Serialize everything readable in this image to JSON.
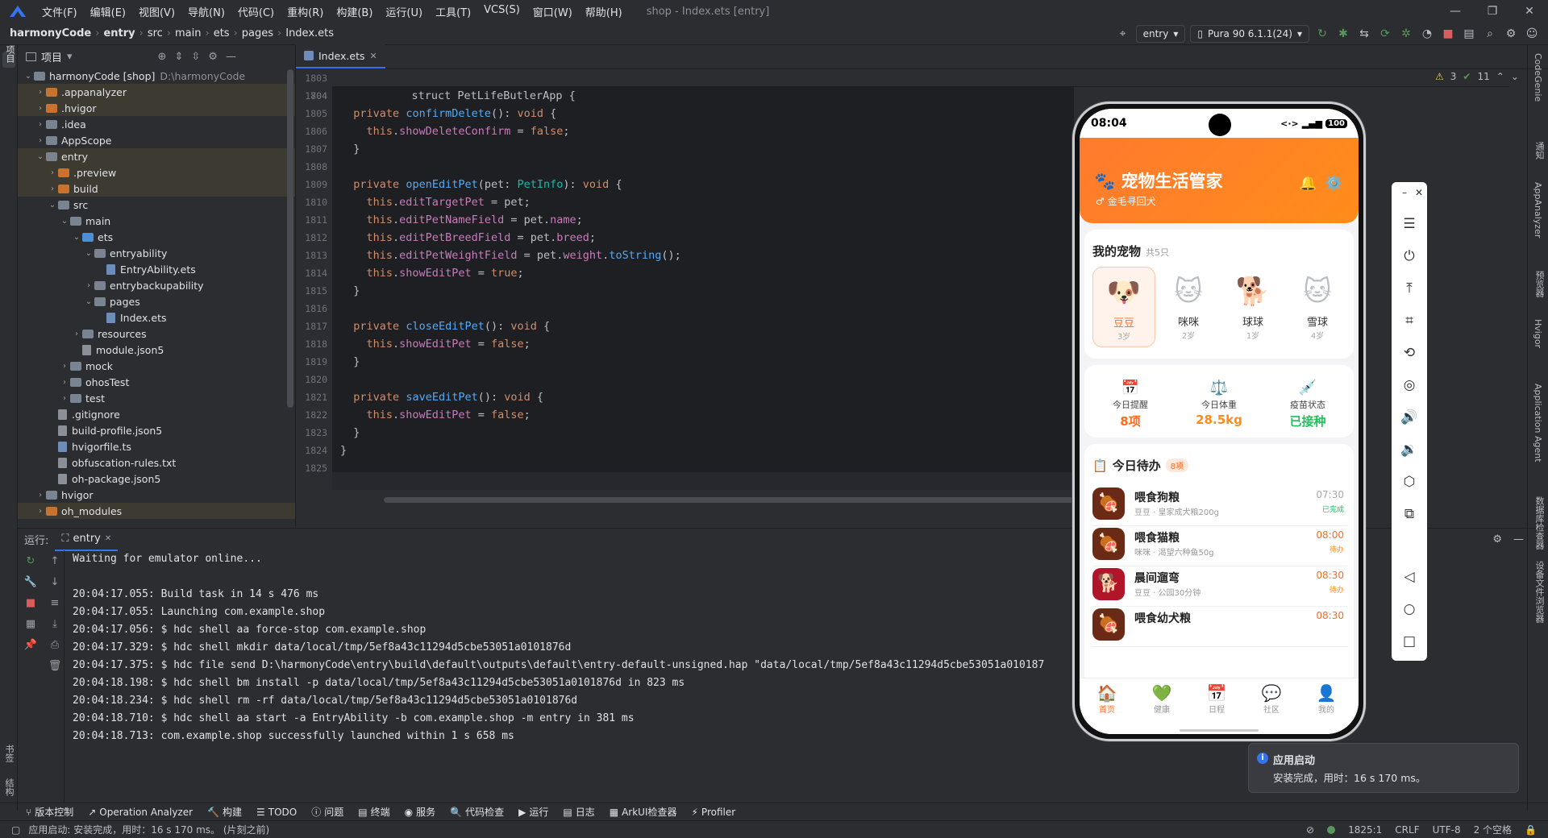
{
  "menu": [
    "文件(F)",
    "编辑(E)",
    "视图(V)",
    "导航(N)",
    "代码(C)",
    "重构(R)",
    "构建(B)",
    "运行(U)",
    "工具(T)",
    "VCS(S)",
    "窗口(W)",
    "帮助(H)"
  ],
  "window_title": "shop - Index.ets [entry]",
  "breadcrumb": [
    "harmonyCode",
    "entry",
    "src",
    "main",
    "ets",
    "pages",
    "Index.ets"
  ],
  "run_config": "entry",
  "device": "Pura 90 6.1.1(24)",
  "project_panel": {
    "title": "项目",
    "tree": [
      {
        "label": "harmonyCode [shop]",
        "extra": "D:\\harmonyCode",
        "indent": 0,
        "type": "g",
        "open": true,
        "hl": false
      },
      {
        "label": ".appanalyzer",
        "indent": 1,
        "type": "o",
        "open": false,
        "hl": true
      },
      {
        "label": ".hvigor",
        "indent": 1,
        "type": "o",
        "open": false,
        "hl": true
      },
      {
        "label": ".idea",
        "indent": 1,
        "type": "g",
        "open": false,
        "hl": false
      },
      {
        "label": "AppScope",
        "indent": 1,
        "type": "g",
        "open": false,
        "hl": false
      },
      {
        "label": "entry",
        "indent": 1,
        "type": "g",
        "open": true,
        "hl": true
      },
      {
        "label": ".preview",
        "indent": 2,
        "type": "o",
        "open": false,
        "hl": true
      },
      {
        "label": "build",
        "indent": 2,
        "type": "o",
        "open": false,
        "hl": true
      },
      {
        "label": "src",
        "indent": 2,
        "type": "g",
        "open": true,
        "hl": false
      },
      {
        "label": "main",
        "indent": 3,
        "type": "g",
        "open": true,
        "hl": false
      },
      {
        "label": "ets",
        "indent": 4,
        "type": "b",
        "open": true,
        "hl": false
      },
      {
        "label": "entryability",
        "indent": 5,
        "type": "g",
        "open": true,
        "hl": false
      },
      {
        "label": "EntryAbility.ets",
        "indent": 6,
        "type": "file",
        "hl": false
      },
      {
        "label": "entrybackupability",
        "indent": 5,
        "type": "g",
        "open": false,
        "hl": false
      },
      {
        "label": "pages",
        "indent": 5,
        "type": "g",
        "open": true,
        "hl": false
      },
      {
        "label": "Index.ets",
        "indent": 6,
        "type": "file",
        "hl": false
      },
      {
        "label": "resources",
        "indent": 4,
        "type": "g",
        "open": false,
        "hl": false
      },
      {
        "label": "module.json5",
        "indent": 4,
        "type": "json",
        "hl": false
      },
      {
        "label": "mock",
        "indent": 3,
        "type": "g",
        "open": false,
        "hl": false
      },
      {
        "label": "ohosTest",
        "indent": 3,
        "type": "g",
        "open": false,
        "hl": false
      },
      {
        "label": "test",
        "indent": 3,
        "type": "g",
        "open": false,
        "hl": false
      },
      {
        "label": ".gitignore",
        "indent": 2,
        "type": "json",
        "hl": false
      },
      {
        "label": "build-profile.json5",
        "indent": 2,
        "type": "json",
        "hl": false
      },
      {
        "label": "hvigorfile.ts",
        "indent": 2,
        "type": "file",
        "hl": false
      },
      {
        "label": "obfuscation-rules.txt",
        "indent": 2,
        "type": "json",
        "hl": false
      },
      {
        "label": "oh-package.json5",
        "indent": 2,
        "type": "json",
        "hl": false
      },
      {
        "label": "hvigor",
        "indent": 1,
        "type": "g",
        "open": false,
        "hl": false
      },
      {
        "label": "oh_modules",
        "indent": 1,
        "type": "o",
        "open": false,
        "hl": true
      }
    ]
  },
  "editor": {
    "tab": "Index.ets",
    "sticky_line": "704",
    "sticky": "struct PetLifeButlerApp {",
    "first_line": "1803",
    "inspections": {
      "warnings": "3",
      "ok": "11"
    },
    "lines": [
      {
        "n": "1804",
        "html": ""
      },
      {
        "n": "1805",
        "html": "  <span class='kw'>private</span> <span class='fn'>confirmDelete</span>(): <span class='kw'>void</span> {"
      },
      {
        "n": "1806",
        "html": "    <span class='kw'>this</span>.<span class='pr'>showDeleteConfirm</span> = <span class='kw'>false</span>;"
      },
      {
        "n": "1807",
        "html": "  }"
      },
      {
        "n": "1808",
        "html": ""
      },
      {
        "n": "1809",
        "html": "  <span class='kw'>private</span> <span class='fn'>openEditPet</span>(pet: <span class='ty'>PetInfo</span>): <span class='kw'>void</span> {"
      },
      {
        "n": "1810",
        "html": "    <span class='kw'>this</span>.<span class='pr'>editTargetPet</span> = pet;"
      },
      {
        "n": "1811",
        "html": "    <span class='kw'>this</span>.<span class='pr'>editPetNameField</span> = pet.<span class='pr'>name</span>;"
      },
      {
        "n": "1812",
        "html": "    <span class='kw'>this</span>.<span class='pr'>editPetBreedField</span> = pet.<span class='pr'>breed</span>;"
      },
      {
        "n": "1813",
        "html": "    <span class='kw'>this</span>.<span class='pr'>editPetWeightField</span> = pet.<span class='pr'>weight</span>.<span class='fn'>toString</span>();"
      },
      {
        "n": "1814",
        "html": "    <span class='kw'>this</span>.<span class='pr'>showEditPet</span> = <span class='kw'>true</span>;"
      },
      {
        "n": "1815",
        "html": "  }"
      },
      {
        "n": "1816",
        "html": ""
      },
      {
        "n": "1817",
        "html": "  <span class='kw'>private</span> <span class='fn'>closeEditPet</span>(): <span class='kw'>void</span> {"
      },
      {
        "n": "1818",
        "html": "    <span class='kw'>this</span>.<span class='pr'>showEditPet</span> = <span class='kw'>false</span>;"
      },
      {
        "n": "1819",
        "html": "  }"
      },
      {
        "n": "1820",
        "html": ""
      },
      {
        "n": "1821",
        "html": "  <span class='kw'>private</span> <span class='fn'>saveEditPet</span>(): <span class='kw'>void</span> {"
      },
      {
        "n": "1822",
        "html": "    <span class='kw'>this</span>.<span class='pr'>showEditPet</span> = <span class='kw'>false</span>;"
      },
      {
        "n": "1823",
        "html": "  }"
      },
      {
        "n": "1824",
        "html": "}"
      },
      {
        "n": "1825",
        "html": ""
      }
    ]
  },
  "run_panel": {
    "label": "运行:",
    "tab": "entry",
    "output": [
      "Waiting for emulator online...",
      "",
      "20:04:17.055: Build task in 14 s 476 ms",
      "20:04:17.055: Launching com.example.shop",
      "20:04:17.056: $ hdc shell aa force-stop com.example.shop",
      "20:04:17.329: $ hdc shell mkdir data/local/tmp/5ef8a43c11294d5cbe53051a0101876d",
      "20:04:17.375: $ hdc file send D:\\harmonyCode\\entry\\build\\default\\outputs\\default\\entry-default-unsigned.hap \"data/local/tmp/5ef8a43c11294d5cbe53051a010187",
      "20:04:18.198: $ hdc shell bm install -p data/local/tmp/5ef8a43c11294d5cbe53051a0101876d in 823 ms",
      "20:04:18.234: $ hdc shell rm -rf data/local/tmp/5ef8a43c11294d5cbe53051a0101876d",
      "20:04:18.710: $ hdc shell aa start -a EntryAbility -b com.example.shop -m entry in 381 ms",
      "20:04:18.713: com.example.shop successfully launched within 1 s 658 ms"
    ]
  },
  "phone": {
    "time": "08:04",
    "battery": "100",
    "app_title": "宠物生活管家",
    "app_subtitle": "♂ 金毛寻回犬",
    "pets_title": "我的宠物",
    "pets_count": "共5只",
    "pets": [
      {
        "name": "豆豆",
        "age": "3岁",
        "emoji": "🐶",
        "selected": true
      },
      {
        "name": "咪咪",
        "age": "2岁",
        "emoji": "🐱",
        "selected": false
      },
      {
        "name": "球球",
        "age": "1岁",
        "emoji": "🐕",
        "selected": false
      },
      {
        "name": "雪球",
        "age": "4岁",
        "emoji": "🐱",
        "selected": false
      }
    ],
    "stats": [
      {
        "icon": "📅",
        "label": "今日提醒",
        "value": "8项",
        "color": "#ff6a1f"
      },
      {
        "icon": "⚖️",
        "label": "今日体重",
        "value": "28.5kg",
        "color": "#ff8c1a"
      },
      {
        "icon": "💉",
        "label": "疫苗状态",
        "value": "已接种",
        "color": "#20c05c"
      }
    ],
    "todos_title": "今日待办",
    "todos_badge": "8项",
    "todos": [
      {
        "title": "喂食狗粮",
        "sub": "豆豆 · 皇家成犬粮200g",
        "time": "07:30",
        "status": "已完成",
        "status_color": "#20c05c",
        "time_color": "#aaaaaa",
        "icon": "🍖",
        "bg": "#6b2a16"
      },
      {
        "title": "喂食猫粮",
        "sub": "咪咪 · 渴望六种鱼50g",
        "time": "08:00",
        "status": "待办",
        "status_color": "#ff8c1a",
        "time_color": "#ff6a1f",
        "icon": "🍖",
        "bg": "#6b2a16"
      },
      {
        "title": "晨间遛弯",
        "sub": "豆豆 · 公园30分钟",
        "time": "08:30",
        "status": "待办",
        "status_color": "#ff8c1a",
        "time_color": "#ff6a1f",
        "icon": "🐕",
        "bg": "#b0152a"
      },
      {
        "title": "喂食幼犬粮",
        "sub": "",
        "time": "08:30",
        "status": "",
        "status_color": "#ff8c1a",
        "time_color": "#ff6a1f",
        "icon": "🍖",
        "bg": "#6b2a16"
      }
    ],
    "tabs": [
      {
        "label": "首页",
        "icon": "🏠",
        "on": true
      },
      {
        "label": "健康",
        "icon": "💚",
        "on": false
      },
      {
        "label": "日程",
        "icon": "📅",
        "on": false
      },
      {
        "label": "社区",
        "icon": "💬",
        "on": false
      },
      {
        "label": "我的",
        "icon": "👤",
        "on": false
      }
    ]
  },
  "notification": {
    "title": "应用启动",
    "text": "安装完成，用时：16 s 170 ms。"
  },
  "bottom_tools": [
    "版本控制",
    "Operation Analyzer",
    "构建",
    "TODO",
    "问题",
    "终端",
    "服务",
    "代码检查",
    "运行",
    "日志",
    "ArkUI检查器",
    "Profiler"
  ],
  "status": {
    "message": "应用启动: 安装完成，用时：16 s 170 ms。 (片刻之前)",
    "position": "1825:1",
    "line_sep": "CRLF",
    "encoding": "UTF-8",
    "indent": "2 个空格"
  },
  "left_vtabs": [
    "项目",
    "书签",
    "结构"
  ],
  "right_vtabs": [
    "CodeGenie",
    "通知",
    "AppAnalyzer",
    "预览器",
    "Hvigor",
    "Application Agent",
    "数据库检查器",
    "设备文件浏览器"
  ]
}
